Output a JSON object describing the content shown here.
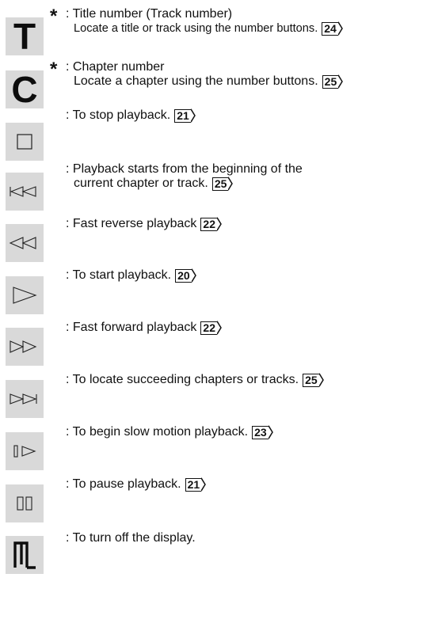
{
  "entries": [
    {
      "icon": "title-T-icon",
      "letter": "T",
      "asterisk": "*",
      "lines": [
        ": Title number (Track number)",
        "Locate a title or track using the number buttons."
      ],
      "ref": "24"
    },
    {
      "icon": "chapter-C-icon",
      "letter": "C",
      "asterisk": "*",
      "lines": [
        ": Chapter number",
        "Locate a chapter using the number buttons."
      ],
      "ref": "25"
    },
    {
      "icon": "stop-icon",
      "lines": [
        ": To stop playback."
      ],
      "ref": "21"
    },
    {
      "icon": "skip-previous-icon",
      "lines": [
        ": Playback starts from the beginning of the",
        "current chapter or track."
      ],
      "ref": "25"
    },
    {
      "icon": "fast-reverse-icon",
      "lines": [
        ": Fast reverse playback"
      ],
      "ref": "22"
    },
    {
      "icon": "play-icon",
      "lines": [
        ": To start playback."
      ],
      "ref": "20"
    },
    {
      "icon": "fast-forward-icon",
      "lines": [
        ": Fast forward playback"
      ],
      "ref": "22"
    },
    {
      "icon": "skip-next-icon",
      "lines": [
        ": To locate succeeding chapters or tracks."
      ],
      "ref": "25"
    },
    {
      "icon": "slow-motion-icon",
      "lines": [
        ": To begin slow motion playback."
      ],
      "ref": "23"
    },
    {
      "icon": "pause-icon",
      "lines": [
        ": To pause playback."
      ],
      "ref": "21"
    },
    {
      "icon": "display-off-icon",
      "lines": [
        ": To turn off the display."
      ],
      "ref": null
    }
  ]
}
